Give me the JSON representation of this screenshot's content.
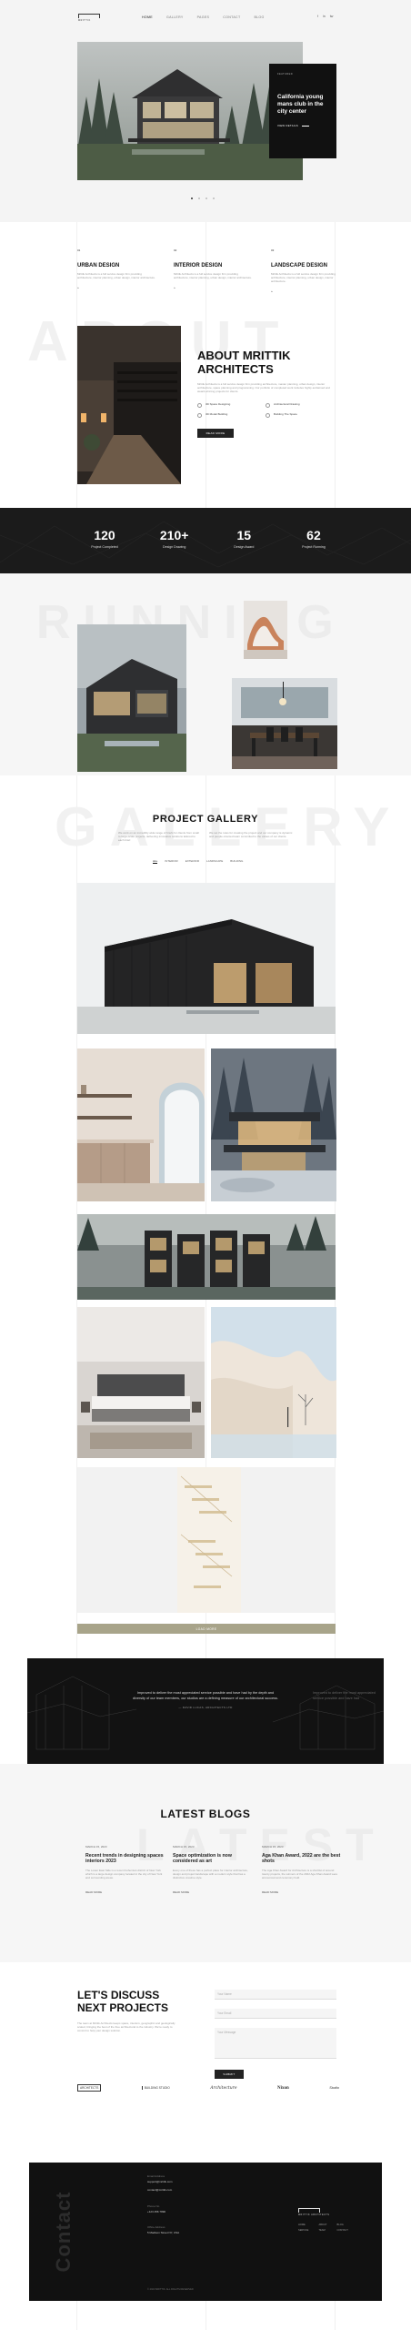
{
  "brand": {
    "logo_text": "MRITTIK",
    "footer_logo_text": "MRITTIK ARCHITECTS"
  },
  "nav": {
    "items": [
      "HOME",
      "GALLERY",
      "PAGES",
      "CONTACT",
      "BLOG"
    ],
    "social": [
      "f",
      "in",
      "tw"
    ]
  },
  "hero": {
    "badge": "FEATURED",
    "title": "California young mans club in the city center",
    "cta": "VIEW DETAILS",
    "slide_indicator": "01"
  },
  "services": [
    {
      "num": "01",
      "title": "URBAN DESIGN",
      "text": "Mrittik Architects is a full service design firm providing architecture, interior planning, urban design, interior architecture.",
      "link": "»"
    },
    {
      "num": "02",
      "title": "INTERIOR DESIGN",
      "text": "Mrittik Architects is a full service design firm providing architecture, interior planning, urban design, interior architecture.",
      "link": "»"
    },
    {
      "num": "03",
      "title": "LANDSCAPE DESIGN",
      "text": "Mrittik Architects is a full service design firm providing architecture, interior planning, urban design, interior architecture.",
      "link": "»"
    }
  ],
  "about": {
    "ghost": "ABOUT",
    "title_line1": "ABOUT MRITTIK",
    "title_line2": "ARCHITECTS",
    "text": "Mrittik Architects is a full service design firm providing architecture, master planning, urban design, interior architecture, space planning and programming. Our portfolio of completed work includes highly acclaimed and award-winning projects for clients.",
    "features": [
      "3D Space Designing",
      "Architectural Drawing",
      "3D Model Building",
      "Building The Space"
    ],
    "cta": "READ MORE"
  },
  "stats": [
    {
      "value": "120",
      "label": "Project Completed"
    },
    {
      "value": "210+",
      "label": "Design Drawing"
    },
    {
      "value": "15",
      "label": "Design Award"
    },
    {
      "value": "62",
      "label": "Project Running"
    }
  ],
  "running": {
    "ghost": "RUNNING"
  },
  "gallery": {
    "ghost": "GALLERY",
    "title": "PROJECT GALLERY",
    "intro_left": "We work on an incredibly wide range of briefs for clients from small to large-scale projects, delivering innovative solutions tailored to each brief.",
    "intro_right": "We set the rules for creating the project and our company is dynamic and people oriented team committed to the values of our clients.",
    "filters": [
      "ALL",
      "INTERIOR",
      "EXTERIOR",
      "LANDSCAPE",
      "BUILDING"
    ],
    "load_more": "LOAD MORE"
  },
  "testimonial": {
    "quote": "Improved to deliver the most appreciated service possible and have had by the depth and diversity of our team members, our studios are a defining measure of our architectural success.",
    "author": "— DAVID LUCAS, ARCHITECTS LTD",
    "side_quote": "Improved to deliver the most appreciated service possible and have had"
  },
  "blogs": {
    "ghost": "LATEST",
    "title": "LATEST BLOGS",
    "posts": [
      {
        "date": "MARCH 15, 2023",
        "title": "Recent trends in designing spaces interiors 2023",
        "text": "The Lower East Side is a recent bohemian district of New York which is a large design company located in the city of New York and surrounding areas.",
        "link": "READ MORE"
      },
      {
        "date": "MARCH 15, 2023",
        "title": "Space optimization is now considered as art",
        "text": "Every one of these has a perfect place for interior architecture, design and project landscape with a modern style that has a distinctive creative style.",
        "link": "READ MORE"
      },
      {
        "date": "MARCH 15, 2023",
        "title": "Aga Khan Award, 2022 are the best shots",
        "text": "The Aga Khan Award for Architecture is a shortlist of around twenty projects, the winners of the 2022 Aga Khan Award were announced and ceremony held.",
        "link": "READ MORE"
      }
    ]
  },
  "discuss": {
    "title_line1": "LET'S DISCUSS",
    "title_line2": "NEXT PROJECTS",
    "text": "The team at Mrittik Architects keeps space, interiors, geographic and geologically scaled, bringing the best of the free architectural to the industry. We're ready to commit to help your design solution.",
    "placeholders": [
      "Your Name",
      "Your Email",
      "Your Message"
    ],
    "submit": "SUBMIT"
  },
  "partners": [
    "ARCHITECTS",
    "BUILDING STUDIO",
    "Architecture",
    "Nixon",
    "Studio"
  ],
  "footer": {
    "vertical_word": "Contact",
    "email_label": "Email Address",
    "emails": [
      "support@mrittik.com",
      "contact@mrittik.com"
    ],
    "phone_label": "Phone No",
    "phone": "+123 456 7890",
    "address_label": "Office Address",
    "address": "5 Madison Street NY, USA",
    "menu": [
      "HOME",
      "ABOUT",
      "BLOG",
      "SERVICE",
      "TEAM",
      "CONTACT"
    ],
    "copyright": "© 2023 MRITTIK. ALL RIGHTS RESERVED"
  }
}
